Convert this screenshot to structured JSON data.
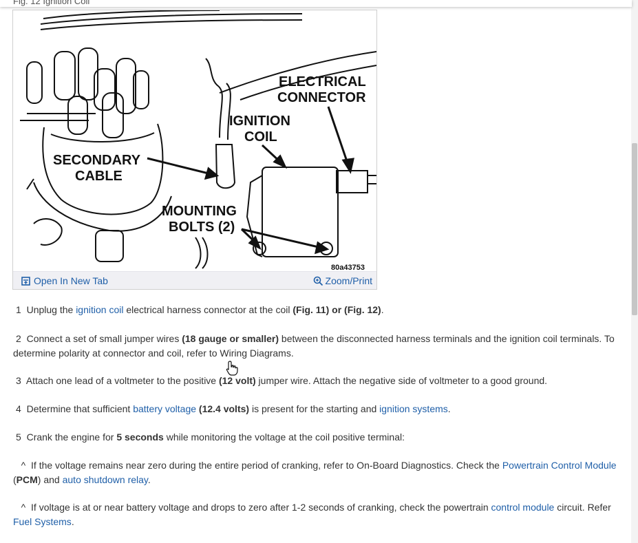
{
  "figure": {
    "caption": "Fig. 12 Ignition Coil",
    "labels": {
      "electrical_connector_1": "ELECTRICAL",
      "electrical_connector_2": "CONNECTOR",
      "ignition_coil_1": "IGNITION",
      "ignition_coil_2": "COIL",
      "secondary_cable_1": "SECONDARY",
      "secondary_cable_2": "CABLE",
      "mounting_bolts_1": "MOUNTING",
      "mounting_bolts_2": "BOLTS (2)",
      "figure_id": "80a43753"
    },
    "open_new_tab": "Open In New Tab",
    "zoom_print": "Zoom/Print"
  },
  "steps": {
    "s1": {
      "num": "1",
      "t1": "Unplug the ",
      "l1": "ignition coil",
      "t2": " electrical harness connector at the coil ",
      "b1": "(Fig. 11) or (Fig. 12)",
      "t3": "."
    },
    "s2": {
      "num": "2",
      "t1": "Connect a set of small jumper wires ",
      "b1": "(18 gauge or smaller)",
      "t2": " between the disconnected harness terminals and the ignition coil terminals. To determine polarity at connector and coil, refer to Wiring Diagrams."
    },
    "s3": {
      "num": "3",
      "t1": "Attach one lead of a voltmeter to the positive ",
      "b1": "(12 volt)",
      "t2": " jumper wire. Attach the negative side of voltmeter to a good ground."
    },
    "s4": {
      "num": "4",
      "t1": "Determine that sufficient ",
      "l1": "battery voltage",
      "t2": " ",
      "b1": "(12.4 volts)",
      "t3": " is present for the starting and ",
      "l2": "ignition systems",
      "t4": "."
    },
    "s5": {
      "num": "5",
      "t1": "Crank the engine for ",
      "b1": "5 seconds",
      "t2": " while monitoring the voltage at the coil positive terminal:"
    },
    "sub1": {
      "caret": "^",
      "t1": "If the voltage remains near zero during the entire period of cranking, refer to On-Board Diagnostics. Check the ",
      "l1": "Powertrain Control Module",
      "t2": " (",
      "b1": "PCM",
      "t3": ") and ",
      "l2": "auto shutdown relay",
      "t4": "."
    },
    "sub2": {
      "caret": "^",
      "t1": "If voltage is at or near battery voltage and drops to zero after 1-2 seconds of cranking, check the powertrain ",
      "l1": "control module",
      "t2": " circuit. Refer ",
      "l2": "Fuel Systems",
      "t3": "."
    }
  },
  "colors": {
    "link": "#1f5fa8",
    "text": "#333333"
  },
  "icons": [
    "open-in-new-tab-icon",
    "zoom-icon",
    "hand-cursor-icon"
  ]
}
